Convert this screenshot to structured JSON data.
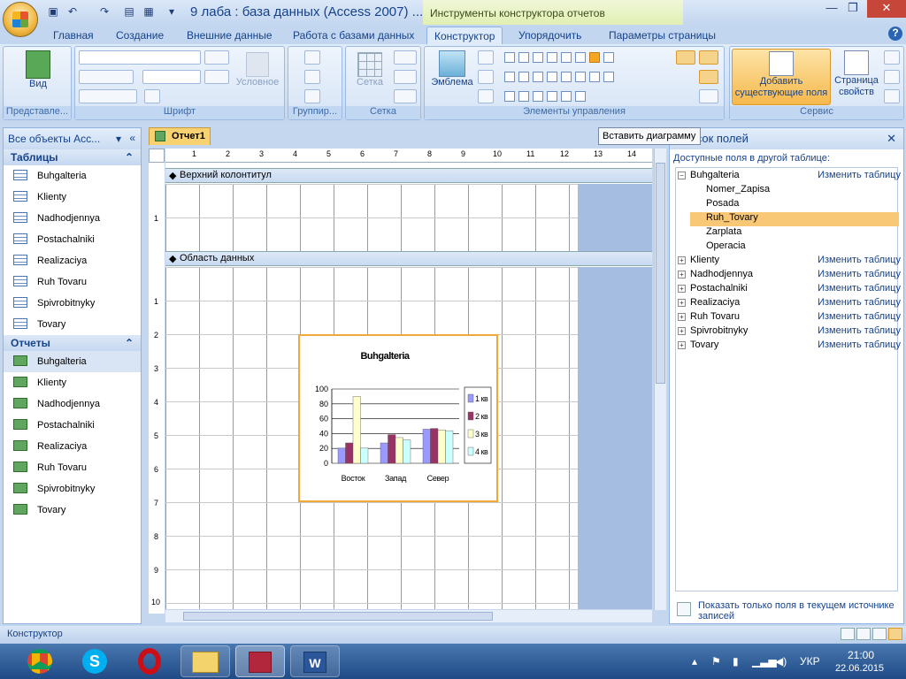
{
  "window": {
    "title": "9 лаба : база данных (Access 2007) ...",
    "context_title": "Инструменты конструктора отчетов"
  },
  "tabs": [
    "Главная",
    "Создание",
    "Внешние данные",
    "Работа с базами данных",
    "Конструктор",
    "Упорядочить",
    "Параметры страницы"
  ],
  "ribbon": {
    "groups": {
      "views": "Представле...",
      "font": "Шрифт",
      "grouping": "Группир...",
      "grid": "Сетка",
      "controls": "Элементы управления",
      "tools": "Сервис"
    },
    "view_label": "Вид",
    "conditional_label": "Условное",
    "grid_label": "Сетка",
    "logo_label": "Эмблема",
    "add_fields_label": "Добавить существующие поля",
    "property_sheet_label": "Страница свойств"
  },
  "tooltip": "Вставить диаграмму",
  "nav": {
    "header": "Все объекты Acc...",
    "tables_header": "Таблицы",
    "tables": [
      "Buhgalteria",
      "Klienty",
      "Nadhodjennya",
      "Postachalniki",
      "Realizaciya",
      "Ruh Tovaru",
      "Spivrobitnyky",
      "Tovary"
    ],
    "reports_header": "Отчеты",
    "reports": [
      "Buhgalteria",
      "Klienty",
      "Nadhodjennya",
      "Postachalniki",
      "Realizaciya",
      "Ruh Tovaru",
      "Spivrobitnyky",
      "Tovary"
    ]
  },
  "document": {
    "tab": "Отчет1",
    "header_section": "Верхний колонтитул",
    "detail_section": "Область данных",
    "ruler_numbers": [
      "1",
      "2",
      "3",
      "4",
      "5",
      "6",
      "7",
      "8",
      "9",
      "10",
      "11",
      "12",
      "13",
      "14"
    ],
    "vruler_top": [
      "1"
    ],
    "vruler_detail": [
      "1",
      "2",
      "3",
      "4",
      "5",
      "6",
      "7",
      "8",
      "9",
      "10"
    ]
  },
  "chart_data": {
    "type": "bar",
    "title": "Buhgalteria",
    "categories": [
      "Восток",
      "Запад",
      "Север"
    ],
    "series": [
      {
        "name": "1 кв",
        "values": [
          20.4,
          27.4,
          45.9
        ],
        "color": "#9999ff"
      },
      {
        "name": "2 кв",
        "values": [
          27.4,
          38.6,
          46.9
        ],
        "color": "#993366"
      },
      {
        "name": "3 кв",
        "values": [
          90,
          34.6,
          45
        ],
        "color": "#ffffcc"
      },
      {
        "name": "4 кв",
        "values": [
          20.4,
          31.6,
          43.9
        ],
        "color": "#ccffff"
      }
    ],
    "ylim": [
      0,
      100
    ],
    "yticks": [
      "0",
      "20",
      "40",
      "60",
      "80",
      "100"
    ],
    "legend": "right"
  },
  "fields": {
    "header": "Список полей",
    "subheader": "Доступные поля в другой таблице:",
    "edit_label": "Изменить таблицу",
    "expanded_table": "Buhgalteria",
    "expanded_fields": [
      "Nomer_Zapisa",
      "Posada",
      "Ruh_Tovary",
      "Zarplata",
      "Operacia"
    ],
    "selected_field": "Ruh_Tovary",
    "other_tables": [
      "Klienty",
      "Nadhodjennya",
      "Postachalniki",
      "Realizaciya",
      "Ruh Tovaru",
      "Spivrobitnyky",
      "Tovary"
    ],
    "footer": "Показать только поля в текущем источнике записей"
  },
  "status": {
    "mode": "Конструктор"
  },
  "taskbar": {
    "lang": "УКР",
    "time": "21:00",
    "date": "22.06.2015"
  }
}
